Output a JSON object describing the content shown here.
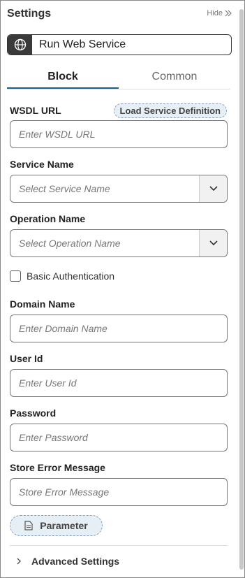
{
  "panel": {
    "title": "Settings",
    "hide_label": "Hide",
    "block_name": "Run Web Service"
  },
  "tabs": [
    {
      "label": "Block",
      "active": true
    },
    {
      "label": "Common",
      "active": false
    }
  ],
  "fields": {
    "wsdl_url": {
      "label": "WSDL URL",
      "placeholder": "Enter WSDL URL",
      "action_label": "Load Service Definition"
    },
    "service_name": {
      "label": "Service Name",
      "placeholder": "Select Service Name"
    },
    "operation_name": {
      "label": "Operation Name",
      "placeholder": "Select Operation Name"
    },
    "basic_auth": {
      "label": "Basic Authentication",
      "checked": false
    },
    "domain_name": {
      "label": "Domain Name",
      "placeholder": "Enter Domain Name"
    },
    "user_id": {
      "label": "User Id",
      "placeholder": "Enter User Id"
    },
    "password": {
      "label": "Password",
      "placeholder": "Enter Password"
    },
    "store_error": {
      "label": "Store Error Message",
      "placeholder": "Store Error Message"
    }
  },
  "parameter_button": {
    "label": "Parameter",
    "icon": "document-icon"
  },
  "advanced": {
    "label": "Advanced Settings",
    "icon": "chevron-right-icon"
  },
  "colors": {
    "accent": "#1a5e8a",
    "pill_bg": "#e6eef6",
    "icon_bg": "#3a3a3a"
  }
}
